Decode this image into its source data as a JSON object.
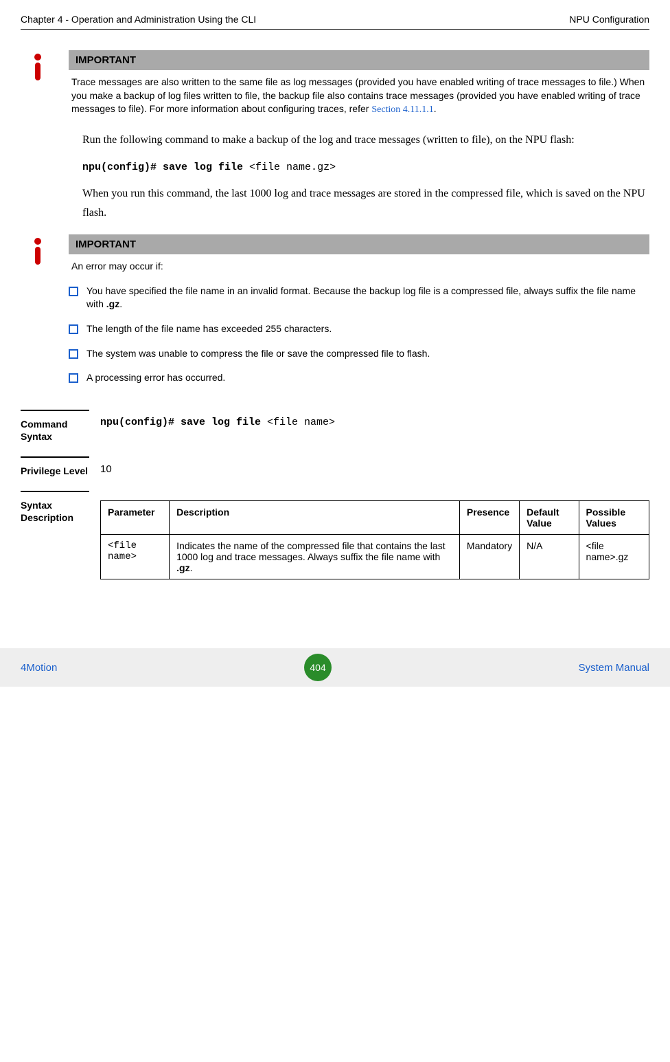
{
  "header": {
    "left": "Chapter 4 - Operation and Administration Using the CLI",
    "right": "NPU Configuration"
  },
  "important1": {
    "title": "IMPORTANT",
    "text_before_link": "Trace messages are also written to the same file as log messages (provided you have enabled writing of trace messages to file.) When you make a backup of log files written to file, the backup file also contains trace messages (provided you have enabled writing of trace messages to file). For more information about configuring traces, refer  ",
    "link": "Section 4.11.1.1",
    "text_after_link": "."
  },
  "body1": "Run the following command to make a backup of the log and trace messages (written to file), on the NPU flash:",
  "cmd1_bold": "npu(config)# save log file ",
  "cmd1_rest": "<file name.gz>",
  "body2": "When you run this command, the last 1000 log and trace messages are stored in the compressed file, which is saved on the NPU flash.",
  "important2": {
    "title": "IMPORTANT",
    "lead": "An error may occur if:",
    "bullets": [
      {
        "pre": "You have specified the file name in an invalid format. Because the backup log file is a compressed file, always suffix the file name with ",
        "bold": ".gz",
        "post": "."
      },
      {
        "pre": "The length of the file name has exceeded 255 characters.",
        "bold": "",
        "post": ""
      },
      {
        "pre": "The system was unable to compress the file or save the compressed file to flash.",
        "bold": "",
        "post": ""
      },
      {
        "pre": "A processing error has occurred.",
        "bold": "",
        "post": ""
      }
    ]
  },
  "command_syntax": {
    "label": "Command Syntax",
    "bold": "npu(config)# save log file ",
    "rest": "<file name>"
  },
  "privilege": {
    "label": "Privilege Level",
    "value": "10"
  },
  "syntax_desc": {
    "label": "Syntax Description",
    "headers": [
      "Parameter",
      "Description",
      "Presence",
      "Default Value",
      "Possible Values"
    ],
    "row": {
      "parameter": "<file name>",
      "description_pre": "Indicates the name of the compressed file that contains the last 1000 log and trace messages. Always suffix the file name with ",
      "description_bold": ".gz",
      "description_post": ".",
      "presence": "Mandatory",
      "default": "N/A",
      "possible": "<file name>.gz"
    }
  },
  "footer": {
    "left": "4Motion",
    "page": "404",
    "right": "System Manual"
  }
}
